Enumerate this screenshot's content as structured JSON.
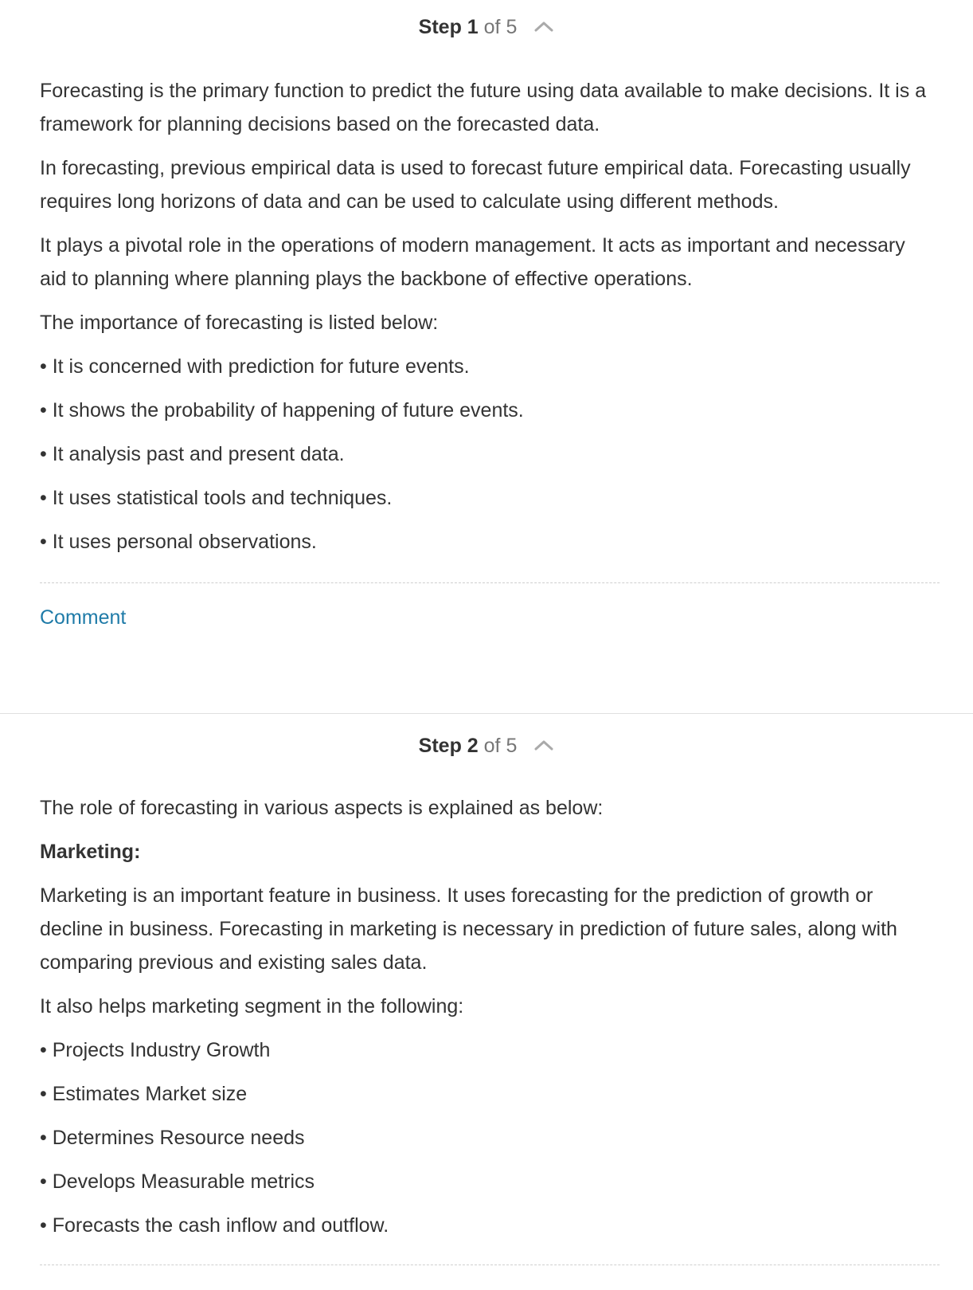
{
  "steps": [
    {
      "step_label": "Step 1",
      "of_label": "of 5",
      "paragraphs": [
        "Forecasting is the primary function to predict the future using data available to make decisions. It is a framework for planning decisions based on the forecasted data.",
        "In forecasting, previous empirical data is used to forecast future empirical data. Forecasting usually requires long horizons of data and can be used to calculate using different methods.",
        "It plays a pivotal role in the operations of modern management. It acts as important and necessary aid to planning where planning plays the backbone of effective operations.",
        "The importance of forecasting is listed below:"
      ],
      "bullets": [
        "• It is concerned with prediction for future events.",
        "• It shows the probability of happening of future events.",
        "• It analysis past and present data.",
        "• It uses statistical tools and techniques.",
        "• It uses personal observations."
      ],
      "comment_label": "Comment"
    },
    {
      "step_label": "Step 2",
      "of_label": "of 5",
      "intro": "The role of forecasting in various aspects is explained as below:",
      "subheading": "Marketing:",
      "paragraphs": [
        "Marketing is an important feature in business. It uses forecasting for the prediction of growth or decline in business. Forecasting in marketing is necessary in prediction of future sales, along with comparing previous and existing sales data.",
        "It also helps marketing segment in the following:"
      ],
      "bullets": [
        "• Projects Industry Growth",
        "• Estimates Market size",
        "• Determines Resource needs",
        "• Develops Measurable metrics",
        "• Forecasts the cash inflow and outflow."
      ]
    }
  ],
  "icons": {
    "collapse": "chevron-up-icon"
  },
  "colors": {
    "text": "#333333",
    "muted": "#767676",
    "link": "#1f7ba8",
    "chevron": "#aaaaaa",
    "divider": "#e0e0e0"
  }
}
